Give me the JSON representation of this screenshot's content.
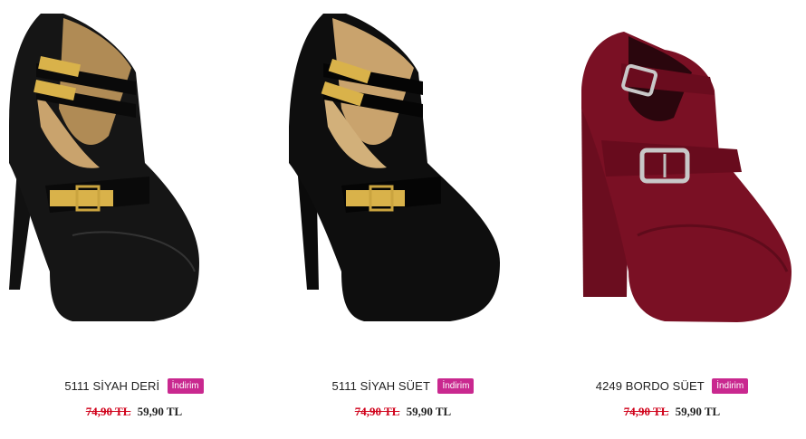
{
  "products": [
    {
      "title": "5111 SİYAH DERİ",
      "badge": "İndirim",
      "old_price": "74,90 TL",
      "new_price": "59,90 TL",
      "color": "#111111"
    },
    {
      "title": "5111 SİYAH SÜET",
      "badge": "İndirim",
      "old_price": "74,90 TL",
      "new_price": "59,90 TL",
      "color": "#0b0b0b"
    },
    {
      "title": "4249 BORDO SÜET",
      "badge": "İndirim",
      "old_price": "74,90 TL",
      "new_price": "59,90 TL",
      "color": "#7a1024"
    }
  ],
  "colors": {
    "badge": "#c9288f",
    "old_price": "#d0021b",
    "gold": "#d9b24a",
    "silver": "#c8c8c8"
  }
}
